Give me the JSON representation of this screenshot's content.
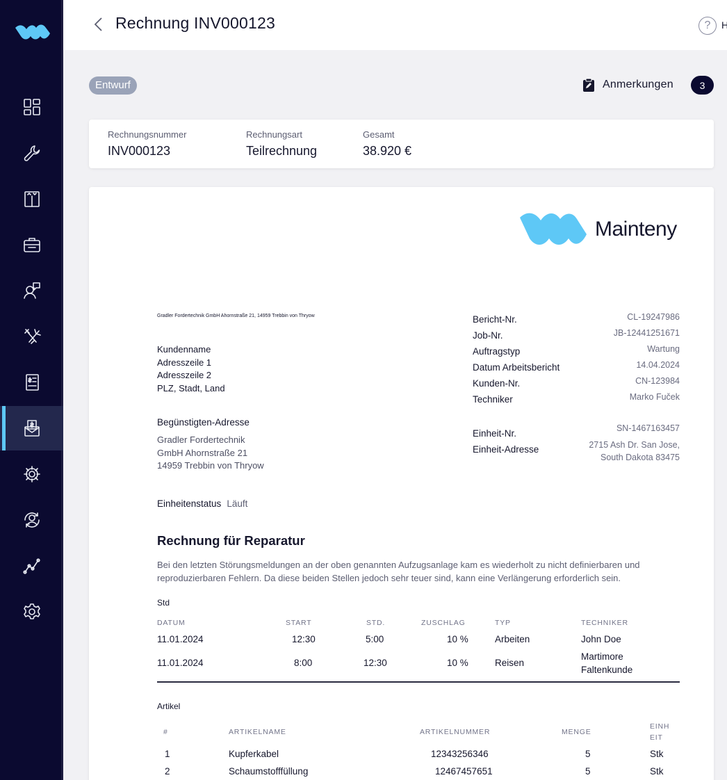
{
  "header": {
    "title": "Rechnung INV000123",
    "help_label": "H"
  },
  "status": {
    "badge": "Entwurf",
    "notes_label": "Anmerkungen",
    "notes_count": "3"
  },
  "summary": [
    {
      "label": "Rechnungsnummer",
      "value": "INV000123"
    },
    {
      "label": "Rechnungsart",
      "value": "Teilrechnung"
    },
    {
      "label": "Gesamt",
      "value": "38.920 €"
    }
  ],
  "doc": {
    "brand_name": "Mainteny",
    "sender_line": "Gradler Fordertechnik GmbH Ahornstraße 21, 14959 Trebbin von Thryow",
    "customer": [
      "Kundenname",
      "Adresszeile 1",
      "Adresszeile 2",
      "PLZ, Stadt, Land"
    ],
    "beneficiary_title": "Begünstigten-Adresse",
    "beneficiary": [
      "Gradler Fordertechnik",
      "GmbH Ahornstraße 21",
      "14959 Trebbin von Thryow"
    ],
    "unit_status_label": "Einheitenstatus",
    "unit_status_value": "Läuft",
    "meta": [
      {
        "k": "Bericht-Nr.",
        "v": "CL-19247986"
      },
      {
        "k": "Job-Nr.",
        "v": "JB-12441251671"
      },
      {
        "k": "Auftragstyp",
        "v": "Wartung"
      },
      {
        "k": "Datum Arbeitsbericht",
        "v": "14.04.2024"
      },
      {
        "k": "Kunden-Nr.",
        "v": "CN-123984"
      },
      {
        "k": "Techniker",
        "v": "Marko Fuček"
      }
    ],
    "unit_no_label": "Einheit-Nr.",
    "unit_no": "SN-1467163457",
    "unit_addr_label": "Einheit-Adresse",
    "unit_addr": [
      "2715 Ash Dr. San Jose,",
      "South Dakota 83475"
    ],
    "section_title": "Rechnung für Reparatur",
    "description": "Bei den letzten Störungsmeldungen an der oben genannten Aufzugsanlage kam es wiederholt zu nicht definierbaren und reproduzierbaren Fehlern. Da diese beiden Stellen jedoch sehr teuer sind, kann eine Verlängerung erforderlich sein.",
    "hours_title": "Std",
    "hours_headers": [
      "DATUM",
      "START",
      "STD.",
      "ZUSCHLAG",
      "TYP",
      "TECHNIKER"
    ],
    "hours_rows": [
      [
        "11.01.2024",
        "12:30",
        "5:00",
        "10 %",
        "Arbeiten",
        "John Doe",
        ""
      ],
      [
        "11.01.2024",
        "8:00",
        "12:30",
        "10 %",
        "Reisen",
        "Martimore",
        "Faltenkunde"
      ]
    ],
    "items_title": "Artikel",
    "items_headers": [
      "#",
      "ARTIKELNAME",
      "ARTIKELNUMMER",
      "MENGE",
      "EINH",
      "EIT"
    ],
    "items_rows": [
      [
        "1",
        "Kupferkabel",
        "12343256346",
        "5",
        "Stk"
      ],
      [
        "2",
        "Schaumstofffüllung",
        "12467457651",
        "5",
        "Stk"
      ]
    ]
  }
}
